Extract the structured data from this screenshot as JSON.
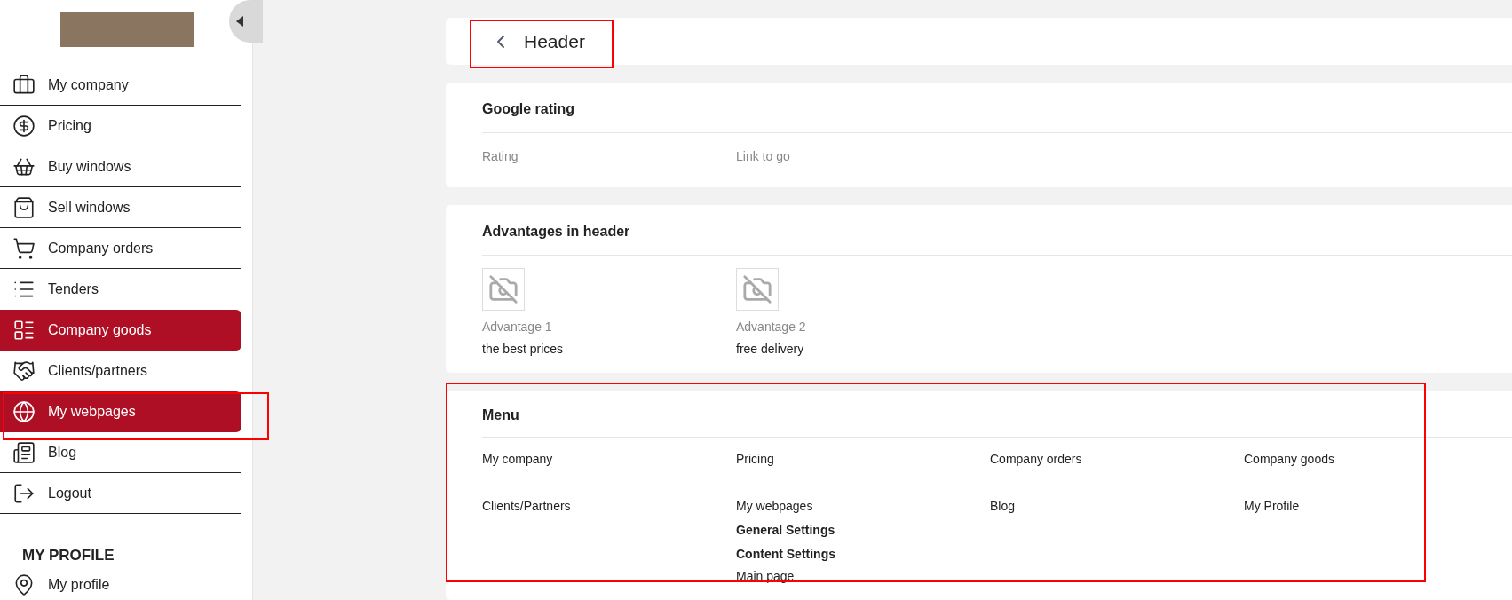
{
  "sidebar": {
    "items": [
      {
        "label": "My company",
        "selected": false
      },
      {
        "label": "Pricing",
        "selected": false
      },
      {
        "label": "Buy windows",
        "selected": false
      },
      {
        "label": "Sell windows",
        "selected": false
      },
      {
        "label": "Company orders",
        "selected": false
      },
      {
        "label": "Tenders",
        "selected": false
      },
      {
        "label": "Company goods",
        "selected": true
      },
      {
        "label": "Clients/partners",
        "selected": false
      },
      {
        "label": "My webpages",
        "selected": true
      },
      {
        "label": "Blog",
        "selected": false
      },
      {
        "label": "Logout",
        "selected": false
      }
    ],
    "profile_heading": "MY PROFILE",
    "profile_items": [
      {
        "label": "My profile"
      }
    ]
  },
  "page": {
    "title": "Header"
  },
  "google_rating": {
    "title": "Google rating",
    "fields": [
      "Rating",
      "Link to go"
    ]
  },
  "advantages": {
    "title": "Advantages in header",
    "items": [
      {
        "label": "Advantage 1",
        "value": "the best prices"
      },
      {
        "label": "Advantage 2",
        "value": "free delivery"
      }
    ]
  },
  "menu": {
    "title": "Menu",
    "columns": [
      [
        {
          "text": "My company",
          "kind": "link"
        },
        {
          "text": "Clients/Partners",
          "kind": "link"
        }
      ],
      [
        {
          "text": "Pricing",
          "kind": "link"
        },
        {
          "text": "My webpages",
          "kind": "link"
        },
        {
          "text": "General Settings",
          "kind": "heading"
        },
        {
          "text": "Content Settings",
          "kind": "heading"
        },
        {
          "text": "Main page",
          "kind": "sublink"
        }
      ],
      [
        {
          "text": "Company orders",
          "kind": "link"
        },
        {
          "text": "Blog",
          "kind": "link"
        }
      ],
      [
        {
          "text": "Company goods",
          "kind": "link"
        },
        {
          "text": "My Profile",
          "kind": "link"
        }
      ]
    ]
  }
}
